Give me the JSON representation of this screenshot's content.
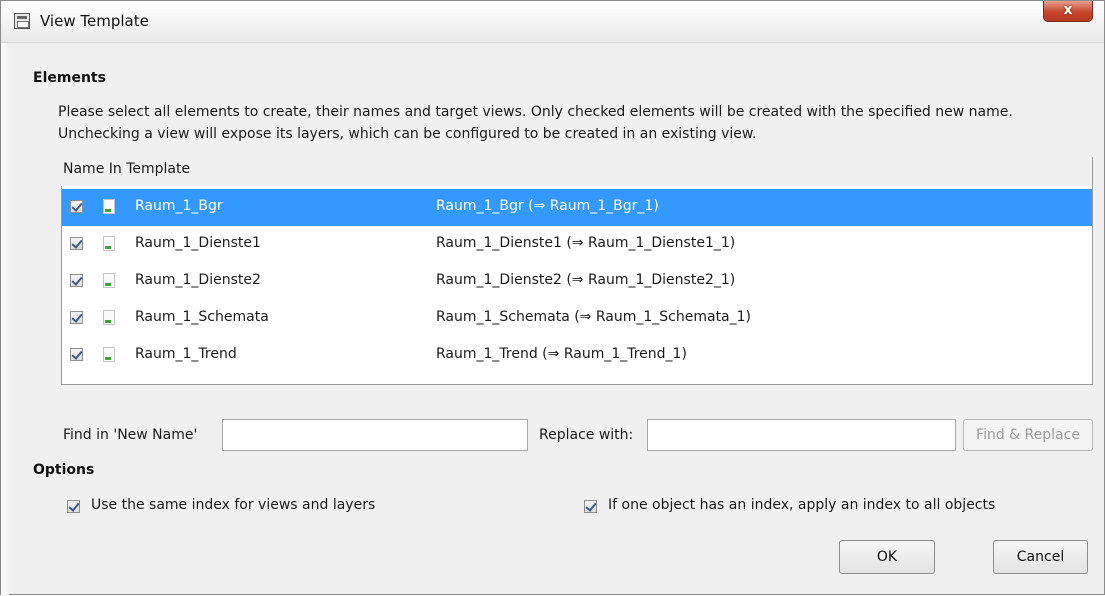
{
  "window": {
    "title": "View Template",
    "close_label": "x"
  },
  "elements": {
    "section_title": "Elements",
    "description_line1": "Please select all elements to create, their names and target views. Only checked elements will be created with the specified new name.",
    "description_line2": "Unchecking a view will expose its layers, which can be configured to be created in an existing view.",
    "column_header": "Name In Template",
    "rows": [
      {
        "checked": true,
        "name": "Raum_1_Bgr",
        "new_name": "Raum_1_Bgr (⇒ Raum_1_Bgr_1)",
        "selected": true
      },
      {
        "checked": true,
        "name": "Raum_1_Dienste1",
        "new_name": "Raum_1_Dienste1 (⇒ Raum_1_Dienste1_1)",
        "selected": false
      },
      {
        "checked": true,
        "name": "Raum_1_Dienste2",
        "new_name": "Raum_1_Dienste2 (⇒ Raum_1_Dienste2_1)",
        "selected": false
      },
      {
        "checked": true,
        "name": "Raum_1_Schemata",
        "new_name": "Raum_1_Schemata (⇒ Raum_1_Schemata_1)",
        "selected": false
      },
      {
        "checked": true,
        "name": "Raum_1_Trend",
        "new_name": "Raum_1_Trend (⇒ Raum_1_Trend_1)",
        "selected": false
      }
    ]
  },
  "find_replace": {
    "find_label": "Find in 'New Name'",
    "find_value": "",
    "replace_label": "Replace with:",
    "replace_value": "",
    "button_label": "Find & Replace"
  },
  "options": {
    "section_title": "Options",
    "same_index_label": "Use the same index for views and layers",
    "same_index_checked": true,
    "apply_index_label": "If one object has an index, apply an index to all objects",
    "apply_index_checked": true
  },
  "buttons": {
    "ok_label": "OK",
    "cancel_label": "Cancel"
  },
  "colors": {
    "selection": "#3399ff",
    "close_button": "#c8452b"
  }
}
